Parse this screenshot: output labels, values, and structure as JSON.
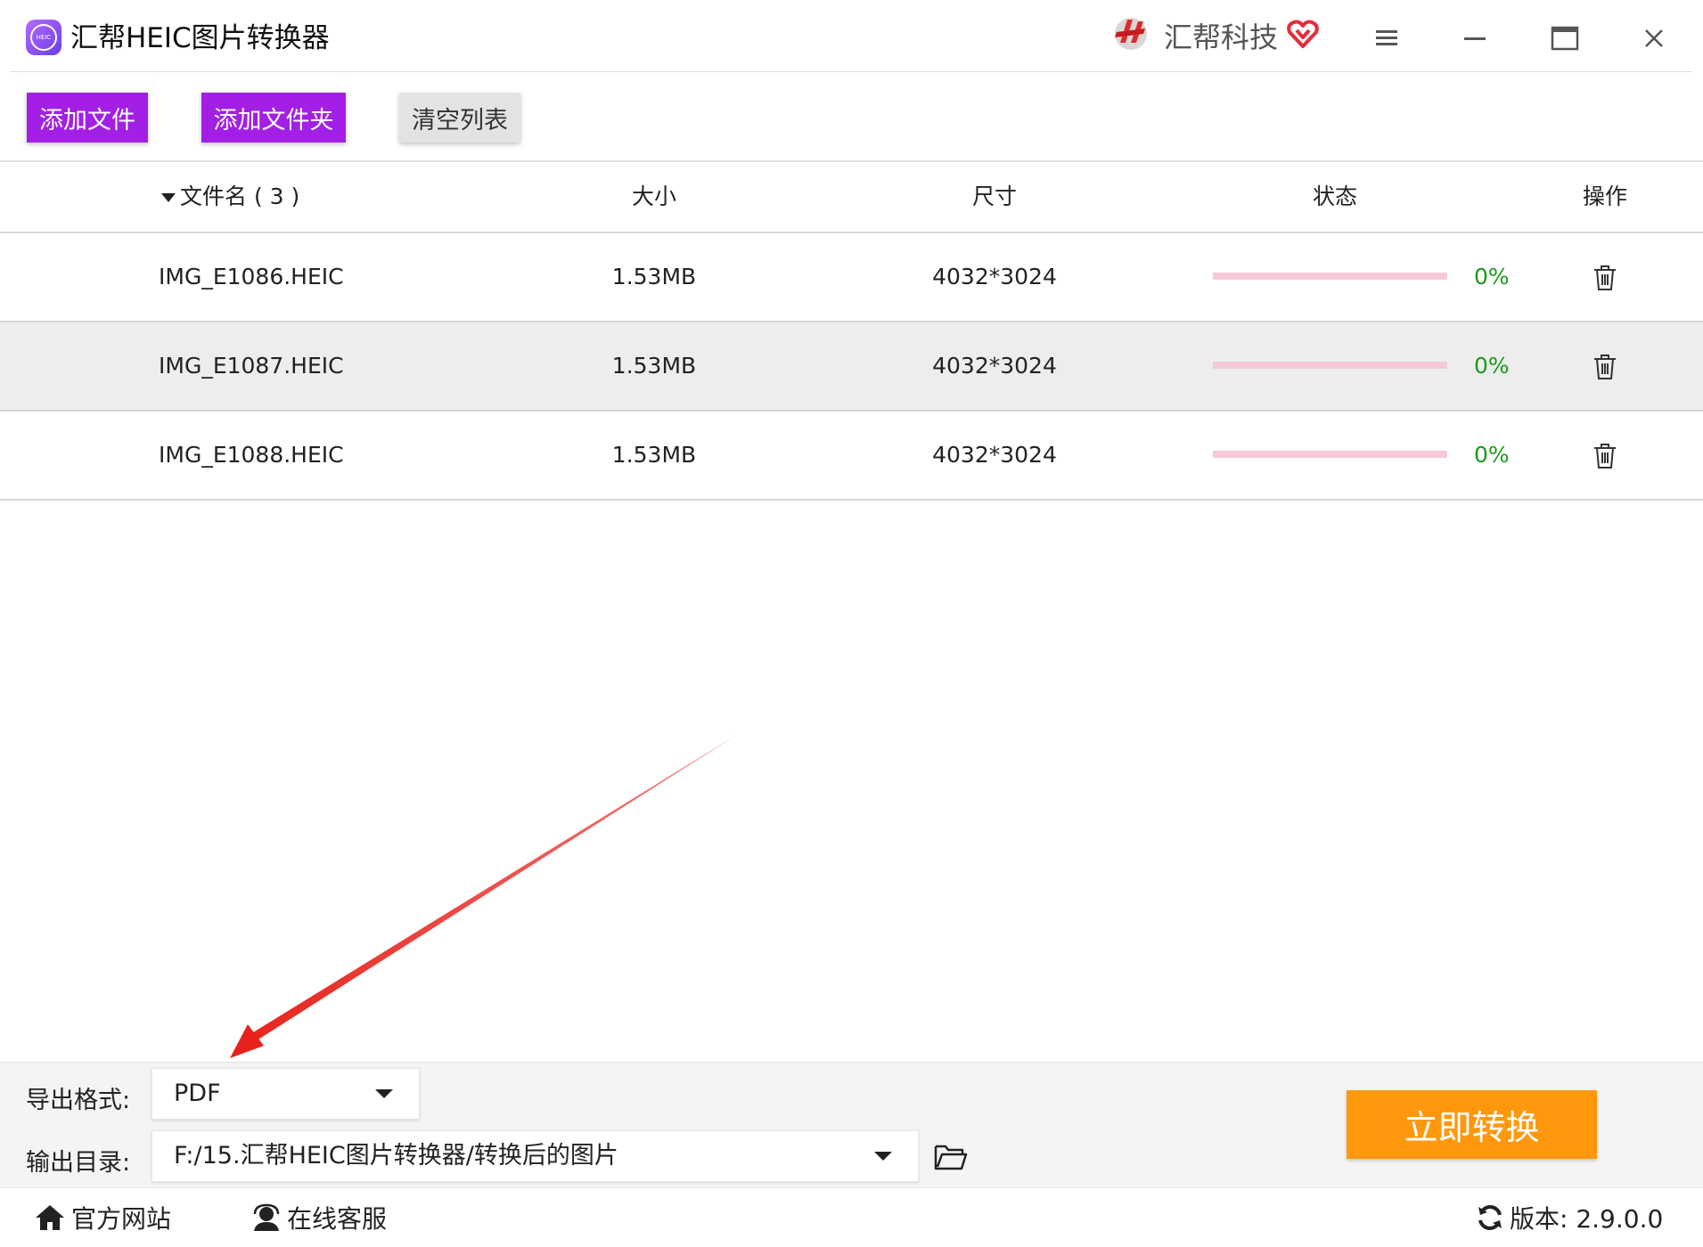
{
  "app": {
    "title": "汇帮HEIC图片转换器",
    "logo_text": "HEIC",
    "brand_name": "汇帮科技"
  },
  "toolbar": {
    "add_file": "添加文件",
    "add_folder": "添加文件夹",
    "clear_list": "清空列表"
  },
  "table": {
    "headers": {
      "filename": "文件名 ( 3 )",
      "size": "大小",
      "dimensions": "尺寸",
      "status": "状态",
      "action": "操作"
    },
    "rows": [
      {
        "name": "IMG_E1086.HEIC",
        "size": "1.53MB",
        "dimensions": "4032*3024",
        "progress": "0%"
      },
      {
        "name": "IMG_E1087.HEIC",
        "size": "1.53MB",
        "dimensions": "4032*3024",
        "progress": "0%"
      },
      {
        "name": "IMG_E1088.HEIC",
        "size": "1.53MB",
        "dimensions": "4032*3024",
        "progress": "0%"
      }
    ]
  },
  "output": {
    "format_label": "导出格式:",
    "format_value": "PDF",
    "dir_label": "输出目录:",
    "dir_value": "F:/15.汇帮HEIC图片转换器/转换后的图片",
    "convert_button": "立即转换"
  },
  "statusbar": {
    "website": "官方网站",
    "support": "在线客服",
    "version": "版本: 2.9.0.0"
  },
  "colors": {
    "purple": "#a31fe5",
    "orange": "#ff980c",
    "progress_green": "#1a9a1a",
    "progress_track": "#f5c9d8",
    "annotation_red": "#e8211b"
  }
}
